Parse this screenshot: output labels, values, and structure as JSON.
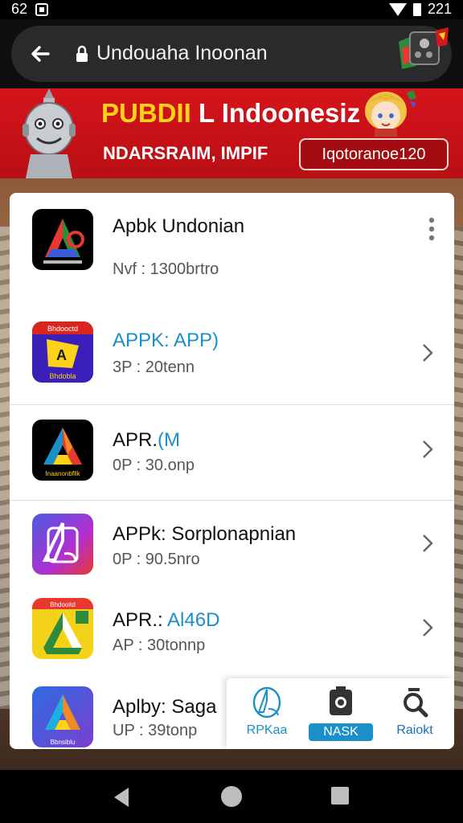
{
  "status_bar": {
    "time_left": "62",
    "time_right": "221"
  },
  "browser": {
    "url": "Undouaha Inoonan"
  },
  "banner": {
    "title_yellow": "PUBDII",
    "title_white": " L Indoonesiz :",
    "subtitle": "NDARSRAIM, IMPIF",
    "code": "Iqotoranoe120"
  },
  "apps": [
    {
      "name": "Apbk Undonian",
      "meta": "Nvf : 1300brtro",
      "colors": [
        "#000000",
        "#e8382f",
        "#2e8b3d",
        "#3b5bd9"
      ]
    },
    {
      "name": "APPK: APP)",
      "name_highlight": true,
      "meta": "3P : 20tenn",
      "badge": "Bhdooctd",
      "badge2": "Bhdobla"
    },
    {
      "name": "APR.",
      "name_suffix": "(M",
      "meta": "0P : 30.onp",
      "badge": "Inaanonbfllk"
    },
    {
      "name": "APPk: Sorplonapnian",
      "meta": "0P : 90.5nro"
    },
    {
      "name": "APR.:",
      "name_suffix": "Al46D",
      "meta": "AP : 30tonnp",
      "badge": "Bhdooitd"
    },
    {
      "name": "Aplby: Saga",
      "meta": "UP : 39tonp",
      "badge": "Bbnsiblu"
    }
  ],
  "actions": [
    {
      "label": "RPKaa",
      "icon": "apk-logo-icon",
      "color": "#1a8fc9"
    },
    {
      "label": "NASK",
      "icon": "camera-icon",
      "color": "#1a8fc9"
    },
    {
      "label": "Raiokt",
      "icon": "search-icon",
      "color": "#1a6fb8"
    }
  ]
}
